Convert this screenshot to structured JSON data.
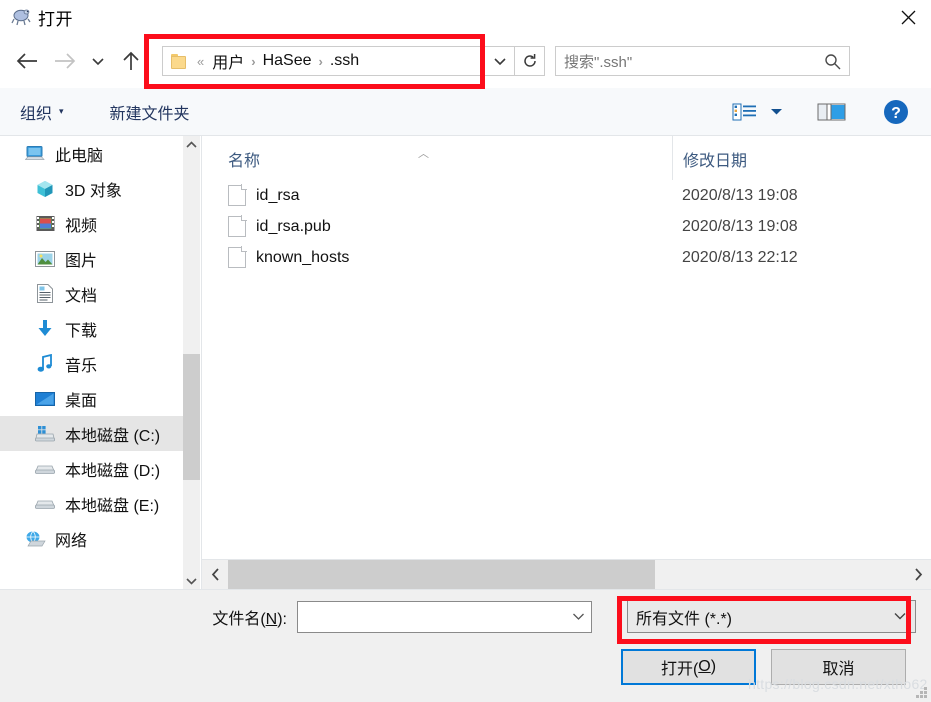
{
  "window": {
    "title": "打开",
    "icon": "python-turtle-icon",
    "close_label": "✕"
  },
  "nav": {
    "back_icon": "arrow-left-icon",
    "forward_icon": "arrow-right-icon",
    "recent_icon": "chevron-down-icon",
    "up_icon": "arrow-up-icon",
    "address_dropdown_icon": "chevron-down-icon",
    "refresh_icon": "refresh-icon",
    "breadcrumb": {
      "folder_icon": "folder-icon",
      "overflow": "«",
      "separator": "›",
      "items": [
        "用户",
        "HaSee",
        ".ssh"
      ]
    },
    "search": {
      "placeholder": "搜索\".ssh\"",
      "icon": "search-icon"
    }
  },
  "toolbar": {
    "organize_label": "组织",
    "organize_caret": "▾",
    "new_folder_label": "新建文件夹",
    "view_icon": "view-list-icon",
    "view_caret": "▾",
    "preview_pane_icon": "preview-pane-icon",
    "help_icon": "help-icon",
    "help_glyph": "?"
  },
  "sidebar": {
    "items": [
      {
        "label": "此电脑",
        "icon": "this-pc-icon",
        "indent": false,
        "selected": false
      },
      {
        "label": "3D 对象",
        "icon": "3d-objects-icon",
        "indent": true,
        "selected": false
      },
      {
        "label": "视频",
        "icon": "videos-icon",
        "indent": true,
        "selected": false
      },
      {
        "label": "图片",
        "icon": "pictures-icon",
        "indent": true,
        "selected": false
      },
      {
        "label": "文档",
        "icon": "documents-icon",
        "indent": true,
        "selected": false
      },
      {
        "label": "下载",
        "icon": "downloads-icon",
        "indent": true,
        "selected": false
      },
      {
        "label": "音乐",
        "icon": "music-icon",
        "indent": true,
        "selected": false
      },
      {
        "label": "桌面",
        "icon": "desktop-icon",
        "indent": true,
        "selected": false
      },
      {
        "label": "本地磁盘 (C:)",
        "icon": "drive-windows-icon",
        "indent": true,
        "selected": true
      },
      {
        "label": "本地磁盘 (D:)",
        "icon": "drive-icon",
        "indent": true,
        "selected": false
      },
      {
        "label": "本地磁盘 (E:)",
        "icon": "drive-icon",
        "indent": true,
        "selected": false
      },
      {
        "label": "网络",
        "icon": "network-icon",
        "indent": false,
        "selected": false
      }
    ],
    "scroll_up_icon": "chevron-up-icon",
    "scroll_down_icon": "chevron-down-icon"
  },
  "filelist": {
    "columns": [
      "名称",
      "修改日期"
    ],
    "sort_indicator": "︿",
    "rows": [
      {
        "name": "id_rsa",
        "date": "2020/8/13 19:08",
        "icon": "file-icon"
      },
      {
        "name": "id_rsa.pub",
        "date": "2020/8/13 19:08",
        "icon": "file-icon"
      },
      {
        "name": "known_hosts",
        "date": "2020/8/13 22:12",
        "icon": "file-icon"
      }
    ],
    "hscroll_left_icon": "chevron-left-icon",
    "hscroll_right_icon": "chevron-right-icon"
  },
  "footer": {
    "filename_label_pre": "文件名(",
    "filename_accel": "N",
    "filename_label_post": "):",
    "filename_value": "",
    "filename_dropdown_icon": "chevron-down-icon",
    "filetype_value": "所有文件 (*.*)",
    "filetype_dropdown_icon": "chevron-down-icon",
    "open_label_pre": "打开(",
    "open_accel": "O",
    "open_label_post": ")",
    "cancel_label": "取消"
  },
  "annotations": {
    "accent_color": "#fc0d1b",
    "address_box": "address-bar-highlight",
    "filetype_box": "file-type-highlight"
  },
  "watermark": {
    "text": "https://blog.csdn.net/xtho62"
  }
}
